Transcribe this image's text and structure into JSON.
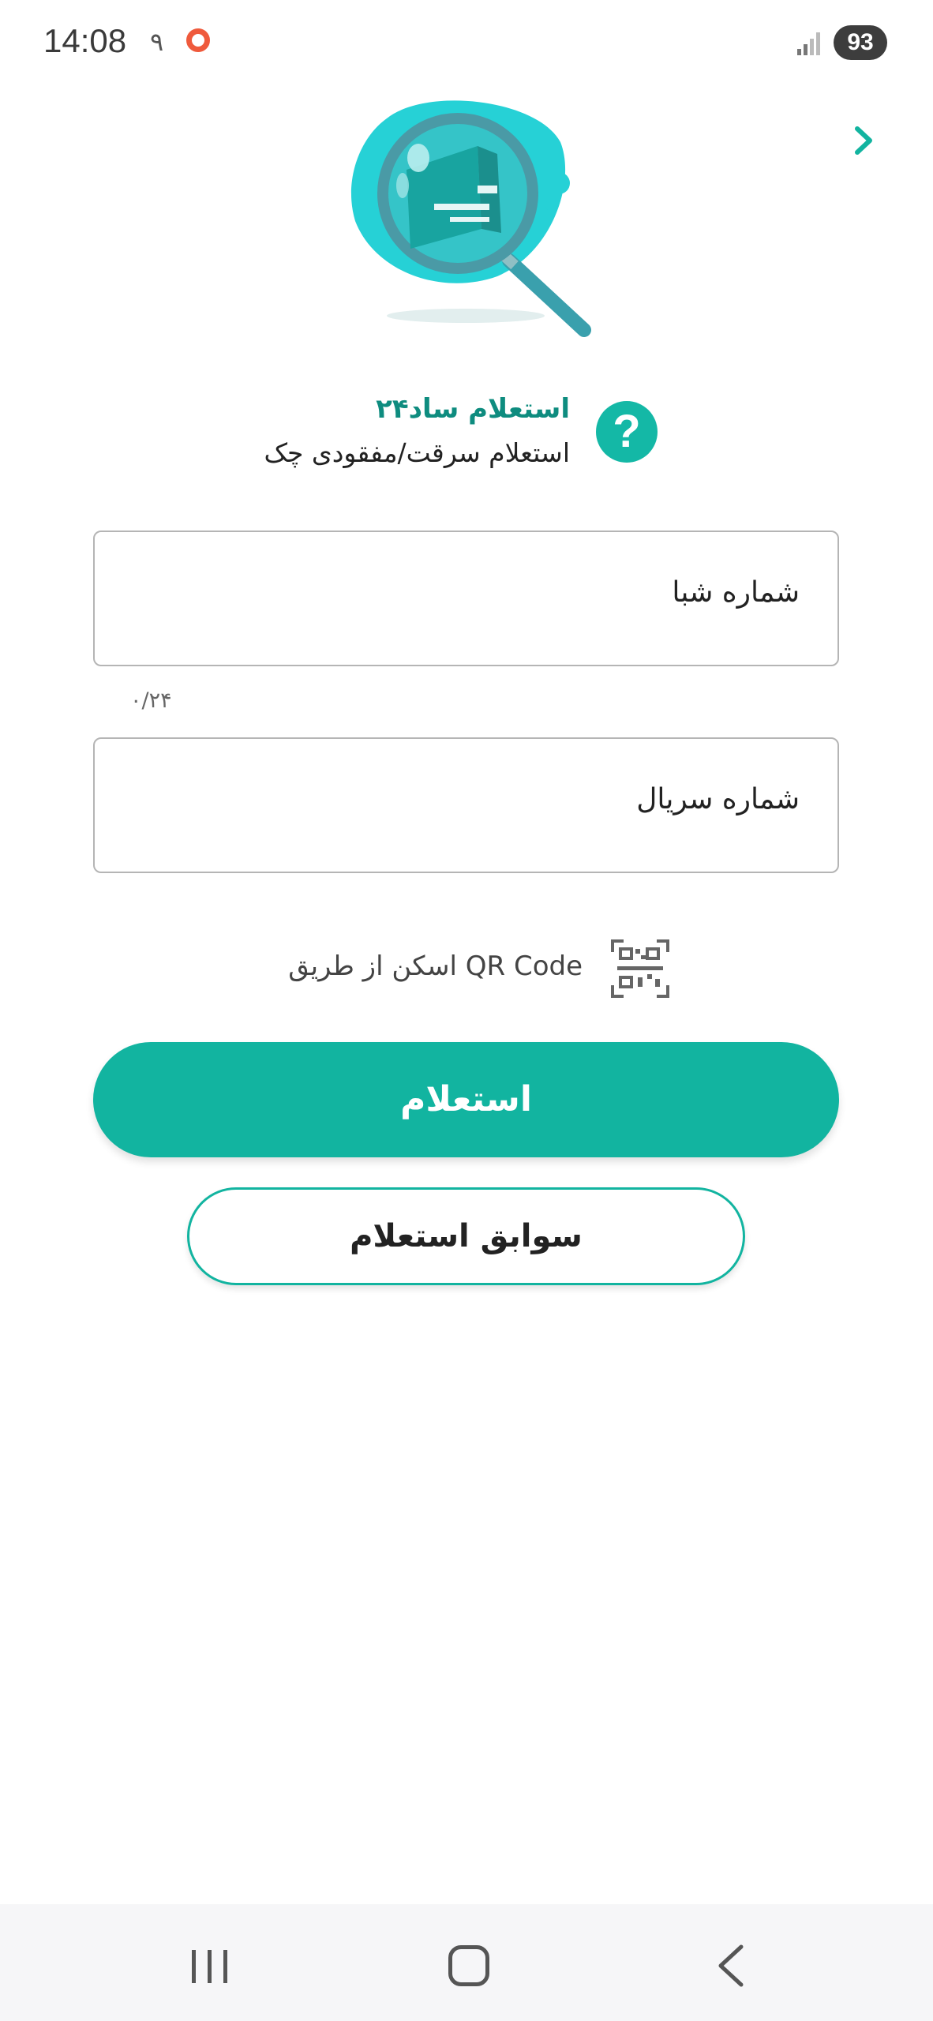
{
  "status_bar": {
    "time": "14:08",
    "extra": "۹",
    "battery": "93"
  },
  "header": {
    "title": "استعلام ساد۲۴",
    "subtitle": "استعلام سرقت/مفقودی چک",
    "help_glyph": "?"
  },
  "form": {
    "sheba_label": "شماره شبا",
    "sheba_counter": "۰/۲۴",
    "serial_label": "شماره سریال",
    "qr_label": "اسکن از طریق QR Code"
  },
  "actions": {
    "inquiry_label": "استعلام",
    "history_label": "سوابق استعلام"
  },
  "colors": {
    "accent": "#12b4a0",
    "title_green": "#0e8c7f",
    "recording_dot": "#ef5a3c"
  },
  "icons": [
    "back-arrow-icon",
    "help-icon",
    "qr-code-icon",
    "nav-recent-icon",
    "nav-home-icon",
    "nav-back-icon"
  ]
}
